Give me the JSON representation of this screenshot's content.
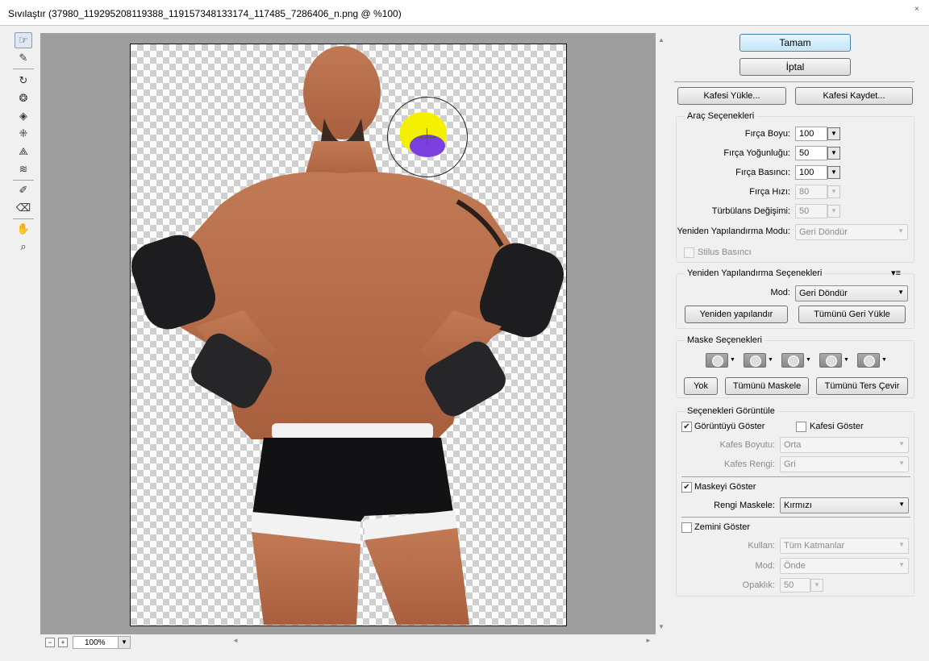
{
  "window": {
    "title": "Sıvılaştır (37980_119295208119388_119157348133174_117485_7286406_n.png @ %100)",
    "close_glyph": "×"
  },
  "toolbar": {
    "tools": [
      {
        "icon": "forward-warp-icon",
        "glyph": "☞",
        "active": true
      },
      {
        "icon": "reconstruct-icon",
        "glyph": "✎"
      },
      {
        "icon": "twirl-icon",
        "glyph": "↻"
      },
      {
        "icon": "pucker-icon",
        "glyph": "❂"
      },
      {
        "icon": "bloat-icon",
        "glyph": "◈"
      },
      {
        "icon": "push-left-icon",
        "glyph": "⁜"
      },
      {
        "icon": "mirror-icon",
        "glyph": "⟁"
      },
      {
        "icon": "turbulence-icon",
        "glyph": "≋"
      },
      {
        "icon": "freeze-mask-icon",
        "glyph": "✐"
      },
      {
        "icon": "thaw-mask-icon",
        "glyph": "⌫"
      },
      {
        "icon": "hand-icon",
        "glyph": "✋"
      },
      {
        "icon": "zoom-icon",
        "glyph": "⌕"
      }
    ]
  },
  "status": {
    "zoom": "100%",
    "zoom_out": "−",
    "zoom_in": "+"
  },
  "buttons": {
    "ok": "Tamam",
    "cancel": "İptal",
    "load_mesh": "Kafesi Yükle...",
    "save_mesh": "Kafesi Kaydet..."
  },
  "tool_options": {
    "title": "Araç Seçenekleri",
    "brush_size_label": "Fırça Boyu:",
    "brush_size": "100",
    "brush_density_label": "Fırça Yoğunluğu:",
    "brush_density": "50",
    "brush_pressure_label": "Fırça Basıncı:",
    "brush_pressure": "100",
    "brush_rate_label": "Fırça Hızı:",
    "brush_rate": "80",
    "turbulent_jitter_label": "Türbülans Değişimi:",
    "turbulent_jitter": "50",
    "recon_mode_label": "Yeniden Yapılandırma Modu:",
    "recon_mode": "Geri Döndür",
    "stylus_pressure_label": "Stilus Basıncı"
  },
  "reconstruct_options": {
    "title": "Yeniden Yapılandırma Seçenekleri",
    "mode_label": "Mod:",
    "mode": "Geri Döndür",
    "reconstruct_btn": "Yeniden yapılandır",
    "restore_all_btn": "Tümünü Geri Yükle"
  },
  "mask_options": {
    "title": "Maske Seçenekleri",
    "none_btn": "Yok",
    "mask_all_btn": "Tümünü Maskele",
    "invert_all_btn": "Tümünü Ters Çevir"
  },
  "view_options": {
    "title": "Seçenekleri Görüntüle",
    "show_image_label": "Görüntüyü Göster",
    "show_image": true,
    "show_mesh_label": "Kafesi Göster",
    "show_mesh": false,
    "mesh_size_label": "Kafes Boyutu:",
    "mesh_size": "Orta",
    "mesh_color_label": "Kafes Rengi:",
    "mesh_color": "Gri",
    "show_mask_label": "Maskeyi Göster",
    "show_mask": true,
    "mask_color_label": "Rengi Maskele:",
    "mask_color": "Kırmızı",
    "show_backdrop_label": "Zemini Göster",
    "show_backdrop": false,
    "use_label": "Kullan:",
    "use": "Tüm Katmanlar",
    "mode_label": "Mod:",
    "mode": "Önde",
    "opacity_label": "Opaklık:",
    "opacity": "50"
  },
  "colors": {
    "brush_freeze": "#f5f000",
    "brush_overlay": "#7b3fe0",
    "canvas_bg": "#9e9e9e",
    "primary_button": "#bee6fd"
  }
}
